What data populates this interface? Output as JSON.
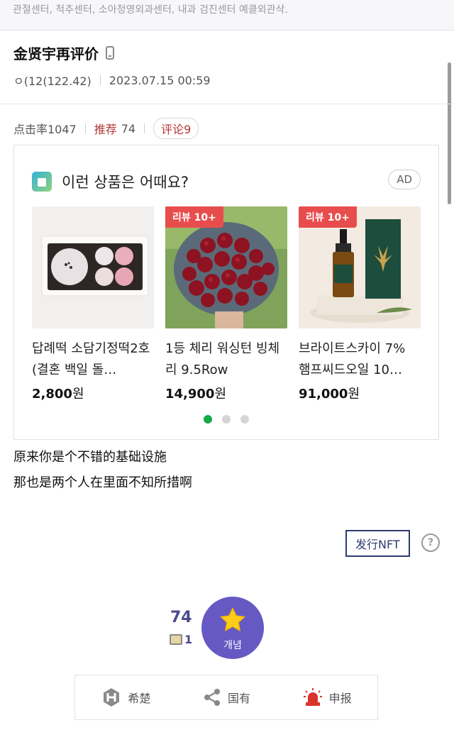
{
  "top_strip": {
    "text": "관절센터, 척추센터, 소아청영외과센터, 내과 검진센터 예클외관삭."
  },
  "post": {
    "title": "金贤宇再评价",
    "author": "ㅇ(12(122.42)",
    "datetime": "2023.07.15 00:59",
    "views_label": "点击率1047",
    "recommend_label": "推荐",
    "recommend_count": "74",
    "comment_label": "评论9"
  },
  "ad": {
    "title": "이런 상품은 어때요?",
    "badge": "AD",
    "products": [
      {
        "name": "답례떡 소담기정떡2호(결혼 백일 돌…",
        "price": "2,800",
        "unit": "원",
        "review_tag": ""
      },
      {
        "name": "1등 체리 워싱턴 빙체리 9.5Row",
        "price": "14,900",
        "unit": "원",
        "review_tag": "리뷰 10+"
      },
      {
        "name": "브라이트스카이 7% 햄프씨드오일 10…",
        "price": "91,000",
        "unit": "원",
        "review_tag": "리뷰 10+"
      }
    ],
    "active_page": 1,
    "page_count": 3
  },
  "body": {
    "line1": "原来你是个不错的基础设施",
    "line2": "那也是两个人在里面不知所措啊"
  },
  "nft_button": "发行NFT",
  "help_icon_text": "?",
  "vote": {
    "count": "74",
    "sub_count": "1",
    "star_label": "개념"
  },
  "share_bar": {
    "hint_label": "希楚",
    "share_label": "国有",
    "report_label": "申报"
  },
  "colors": {
    "accent_purple": "#6659c4",
    "recommend_red": "#b43636",
    "review_tag_red": "#e84d4d",
    "dot_active": "#17a84a",
    "nft_navy": "#2e3a6e"
  }
}
